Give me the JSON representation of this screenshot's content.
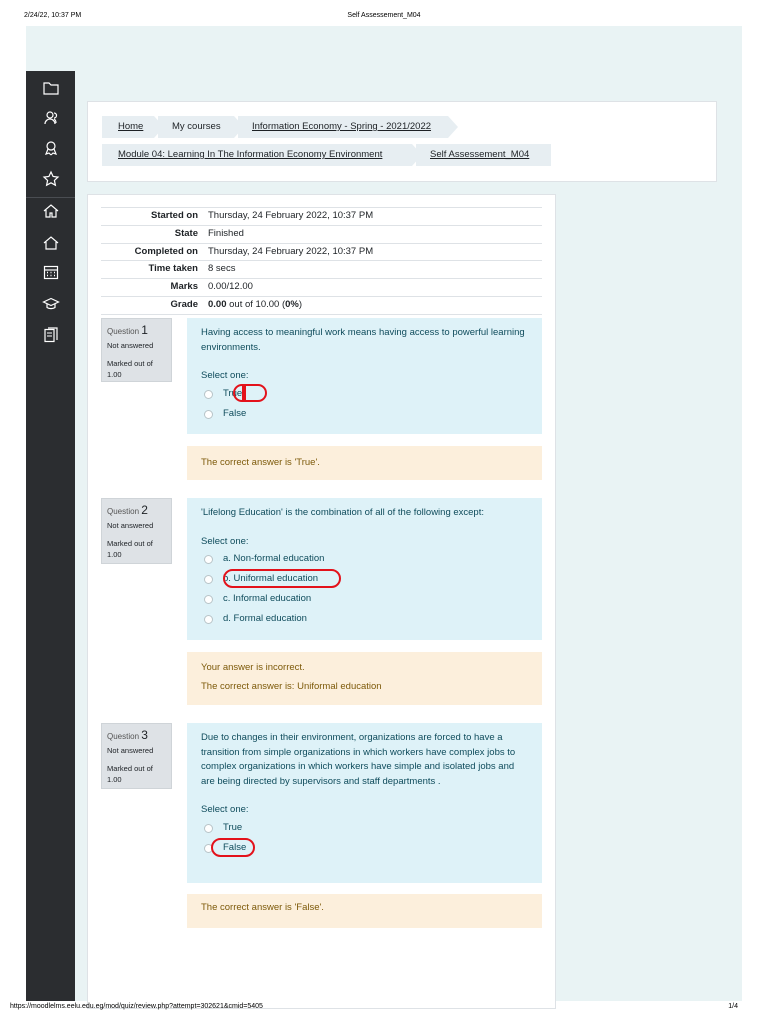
{
  "print": {
    "datetime": "2/24/22, 10:37 PM",
    "title": "Self Assessement_M04",
    "url": "https://moodlelms.eelu.edu.eg/mod/quiz/review.php?attempt=302621&cmid=5405",
    "page": "1/4"
  },
  "sidebar": {
    "icons": [
      "folder-icon",
      "users-icon",
      "badge-icon",
      "star-icon",
      "home-icon",
      "home-icon",
      "calendar-icon",
      "graduation-cap-icon",
      "clipboard-icon"
    ]
  },
  "breadcrumb": {
    "items": [
      "Home",
      "My courses",
      "Information Economy - Spring - 2021/2022",
      "Module 04: Learning In The Information Economy Environment",
      "Self Assessement_M04"
    ]
  },
  "summary": {
    "rows": [
      {
        "label": "Started on",
        "value": "Thursday, 24 February 2022, 10:37 PM"
      },
      {
        "label": "State",
        "value": "Finished"
      },
      {
        "label": "Completed on",
        "value": "Thursday, 24 February 2022, 10:37 PM"
      },
      {
        "label": "Time taken",
        "value": "8 secs"
      },
      {
        "label": "Marks",
        "value": "0.00/12.00"
      }
    ],
    "grade_label": "Grade",
    "grade_bold": "0.00",
    "grade_mid": " out of 10.00 (",
    "grade_pct": "0%",
    "grade_end": ")"
  },
  "questions": [
    {
      "word": "Question",
      "number": "1",
      "state": "Not answered",
      "mark_label": "Marked out of",
      "mark": "1.00",
      "text": "Having access to meaningful work means having access to powerful learning environments.",
      "select_label": "Select one:",
      "options": [
        "True",
        "False"
      ],
      "feedback": [
        "The correct answer is 'True'."
      ]
    },
    {
      "word": "Question",
      "number": "2",
      "state": "Not answered",
      "mark_label": "Marked out of",
      "mark": "1.00",
      "text": "'Lifelong Education' is the combination of all of the following except:",
      "select_label": "Select one:",
      "options": [
        "a. Non-formal education",
        "b. Uniformal education",
        "c. Informal education",
        "d. Formal education"
      ],
      "feedback": [
        "Your answer is incorrect.",
        "The correct answer is: Uniformal education"
      ]
    },
    {
      "word": "Question",
      "number": "3",
      "state": "Not answered",
      "mark_label": "Marked out of",
      "mark": "1.00",
      "text": "Due to changes in their environment, organizations are forced to have a transition from simple organizations in which workers have complex jobs to complex organizations in which workers have simple and isolated jobs and are being directed by supervisors and staff departments .",
      "select_label": "Select one:",
      "options": [
        "True",
        "False"
      ],
      "feedback": [
        "The correct answer is 'False'."
      ]
    }
  ],
  "colors": {
    "annotation": "#e3121b",
    "question_bg": "#def2f8",
    "feedback_bg": "#fcefdc",
    "sidebar_bg": "#2b2d30"
  }
}
